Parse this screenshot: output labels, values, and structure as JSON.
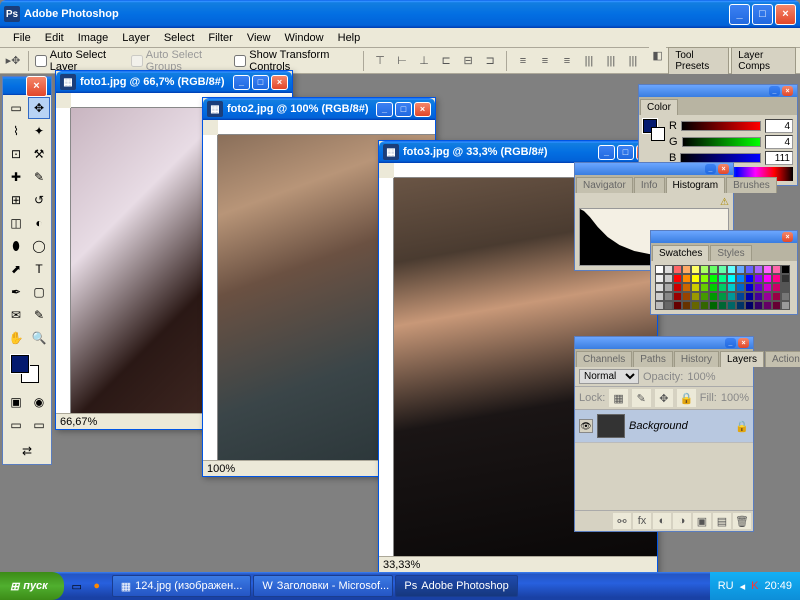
{
  "app": {
    "title": "Adobe Photoshop"
  },
  "menu": [
    "File",
    "Edit",
    "Image",
    "Layer",
    "Select",
    "Filter",
    "View",
    "Window",
    "Help"
  ],
  "options": {
    "auto_select_layer": "Auto Select Layer",
    "auto_select_groups": "Auto Select Groups",
    "show_transform": "Show Transform Controls",
    "tool_presets": "Tool Presets",
    "layer_comps": "Layer Comps"
  },
  "docs": [
    {
      "title": "foto1.jpg @ 66,7% (RGB/8#)",
      "zoom": "66,67%"
    },
    {
      "title": "foto2.jpg @ 100% (RGB/8#)",
      "zoom": "100%"
    },
    {
      "title": "foto3.jpg @ 33,3% (RGB/8#)",
      "zoom": "33,33%"
    }
  ],
  "color_panel": {
    "tab": "Color",
    "r": "4",
    "g": "4",
    "b": "111"
  },
  "nav_panel": {
    "tabs": [
      "Navigator",
      "Info",
      "Histogram",
      "Brushes"
    ],
    "active": "Histogram"
  },
  "swatch_panel": {
    "tabs": [
      "Swatches",
      "Styles"
    ]
  },
  "layers_panel": {
    "tabs": [
      "Channels",
      "Paths",
      "History",
      "Layers",
      "Actions"
    ],
    "active": "Layers",
    "blend": "Normal",
    "opacity_label": "Opacity:",
    "opacity": "100%",
    "lock_label": "Lock:",
    "fill_label": "Fill:",
    "fill": "100%",
    "layer_name": "Background"
  },
  "taskbar": {
    "start": "пуск",
    "tasks": [
      "124.jpg (изображен...",
      "Заголовки - Microsof...",
      "Adobe Photoshop"
    ],
    "lang": "RU",
    "clock": "20:49"
  },
  "swatch_colors": [
    "#fff",
    "#ddd",
    "#f66",
    "#fa6",
    "#ff6",
    "#af6",
    "#6f6",
    "#6fa",
    "#6ff",
    "#6af",
    "#66f",
    "#a6f",
    "#f6f",
    "#f6a",
    "#000",
    "#eee",
    "#ccc",
    "#f00",
    "#f80",
    "#ff0",
    "#8f0",
    "#0f0",
    "#0f8",
    "#0ff",
    "#08f",
    "#00f",
    "#80f",
    "#f0f",
    "#f08",
    "#333",
    "#ddd",
    "#aaa",
    "#c00",
    "#c60",
    "#cc0",
    "#6c0",
    "#0c0",
    "#0c6",
    "#0cc",
    "#06c",
    "#00c",
    "#60c",
    "#c0c",
    "#c06",
    "#555",
    "#ccc",
    "#888",
    "#900",
    "#940",
    "#990",
    "#490",
    "#090",
    "#094",
    "#099",
    "#049",
    "#009",
    "#409",
    "#909",
    "#904",
    "#777",
    "#bbb",
    "#666",
    "#600",
    "#630",
    "#660",
    "#360",
    "#060",
    "#063",
    "#066",
    "#036",
    "#006",
    "#306",
    "#606",
    "#603",
    "#999"
  ]
}
